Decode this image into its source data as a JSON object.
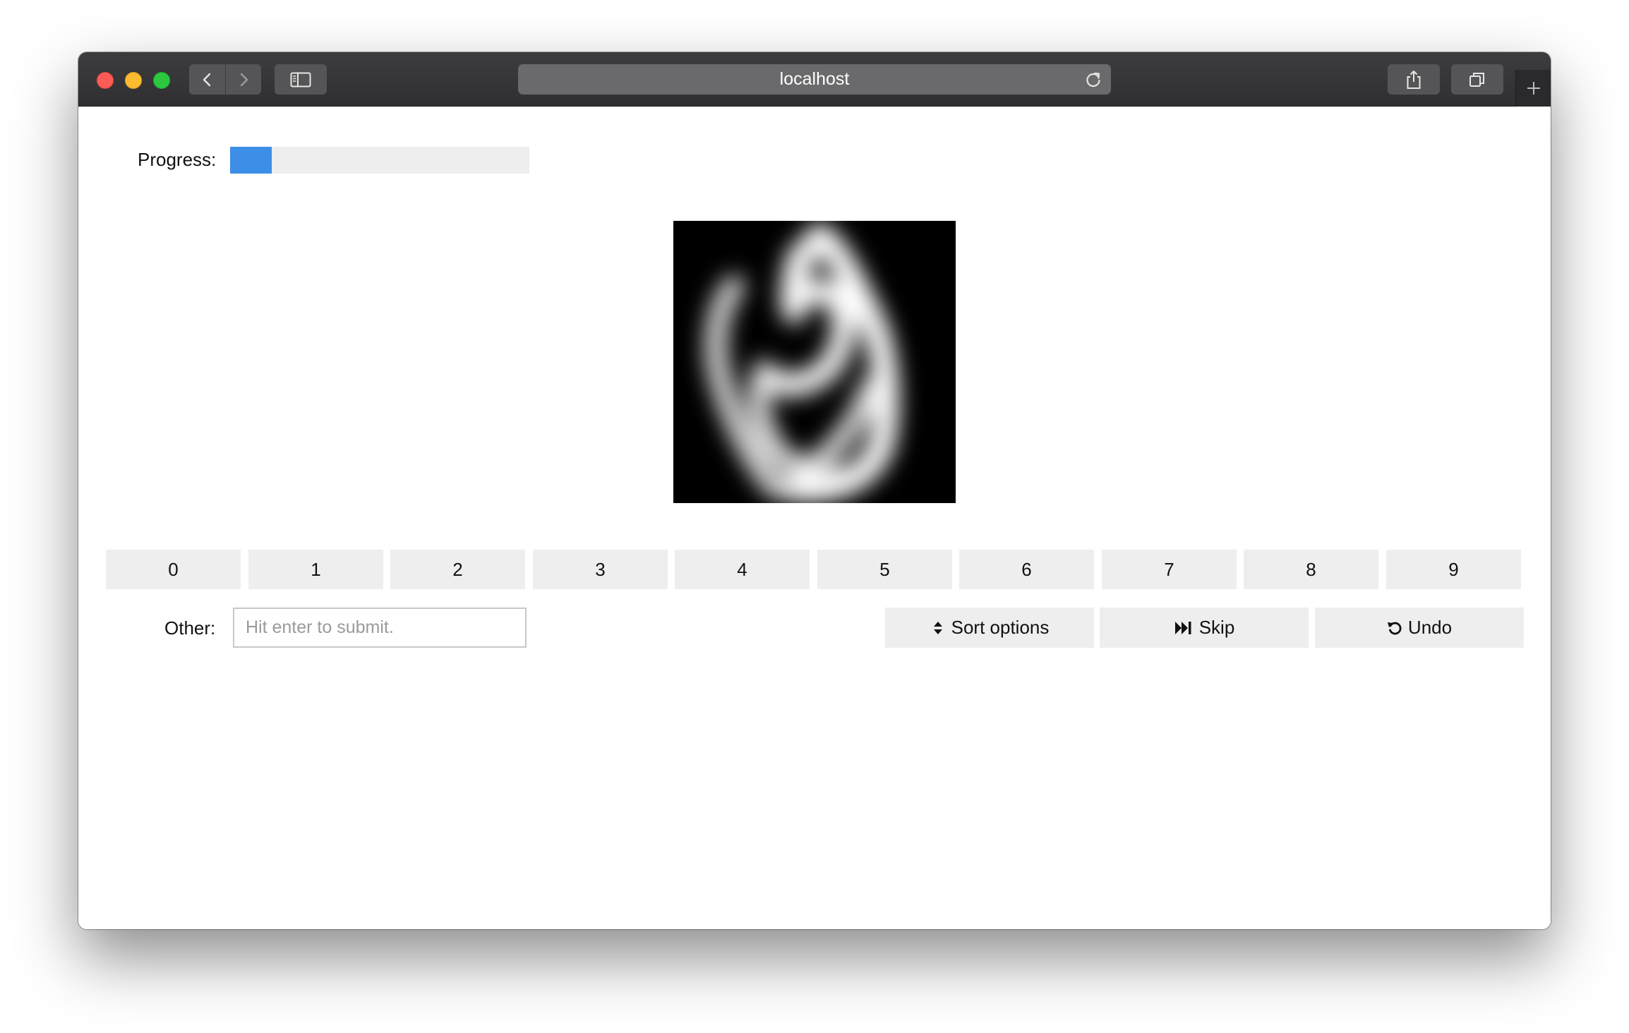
{
  "browser": {
    "url": "localhost",
    "icons": {
      "back": "chevron-left-icon",
      "forward": "chevron-right-icon",
      "sidebar": "sidebar-icon",
      "reload": "reload-icon",
      "share": "share-icon",
      "tabs": "tabs-overview-icon",
      "new_tab": "plus-icon"
    }
  },
  "progress": {
    "label": "Progress:",
    "fraction": 0.14,
    "color": "#3d8ee6"
  },
  "options": [
    "0",
    "1",
    "2",
    "3",
    "4",
    "5",
    "6",
    "7",
    "8",
    "9"
  ],
  "other": {
    "label": "Other:",
    "placeholder": "Hit enter to submit.",
    "value": ""
  },
  "actions": {
    "sort_label": "Sort options",
    "skip_label": "Skip",
    "undo_label": "Undo"
  }
}
